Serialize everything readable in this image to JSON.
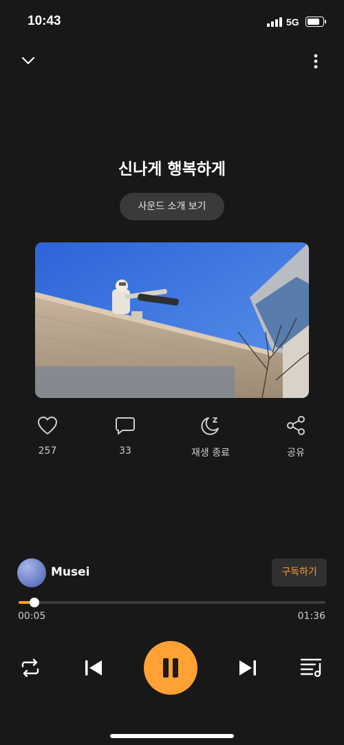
{
  "status_bar": {
    "time": "10:43",
    "network": "5G",
    "icons": [
      "signal-icon",
      "battery-icon"
    ]
  },
  "header": {
    "collapse_icon": "chevron-down-icon",
    "more_icon": "more-vertical-icon"
  },
  "track": {
    "title": "신나게 행복하게",
    "intro_button": "사운드 소개 보기"
  },
  "actions": [
    {
      "icon": "heart-icon",
      "label": "257"
    },
    {
      "icon": "comment-icon",
      "label": "33"
    },
    {
      "icon": "sleep-timer-icon",
      "label": "재생 종료"
    },
    {
      "icon": "share-icon",
      "label": "공유"
    }
  ],
  "artist": {
    "name": "Musei",
    "subscribe_label": "구독하기"
  },
  "progress": {
    "elapsed": "00:05",
    "total": "01:36",
    "fraction": 0.052
  },
  "controls": {
    "icons": [
      "repeat-icon",
      "previous-icon",
      "pause-icon",
      "next-icon",
      "playlist-icon"
    ]
  },
  "colors": {
    "background": "#181818",
    "accent": "#ffa133",
    "subscribe_text": "#ff9c2e"
  }
}
